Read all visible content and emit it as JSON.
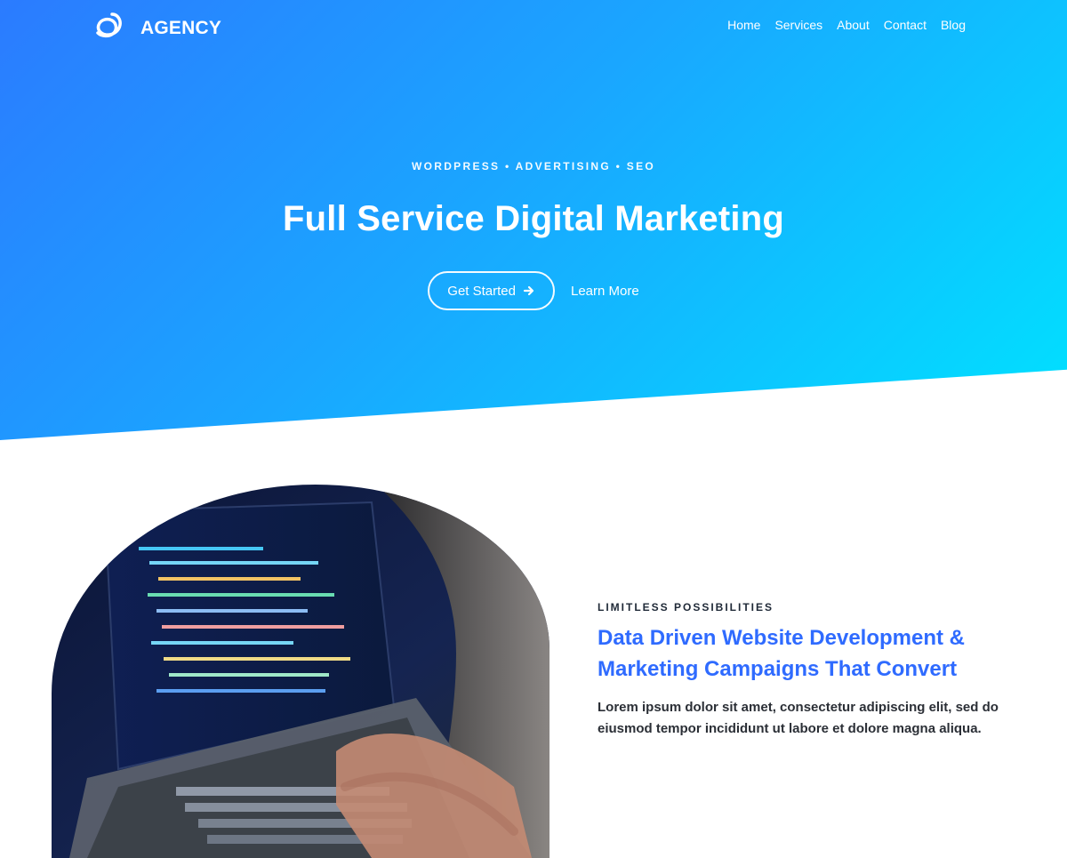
{
  "brand": {
    "name": "AGENCY",
    "logo_icon": "agency-logo-icon"
  },
  "nav": {
    "items": [
      {
        "label": "Home"
      },
      {
        "label": "Services"
      },
      {
        "label": "About"
      },
      {
        "label": "Contact"
      },
      {
        "label": "Blog"
      }
    ]
  },
  "hero": {
    "kicker": "WORDPRESS • ADVERTISING • SEO",
    "title": "Full Service Digital Marketing",
    "primary_cta": {
      "label": "Get Started",
      "icon": "arrow-right-icon"
    },
    "secondary_cta": {
      "label": "Learn More"
    },
    "gradient": {
      "start": "#2b7bff",
      "mid": "#1aa6ff",
      "end": "#00e2ff"
    }
  },
  "content": {
    "eyebrow": "LIMITLESS POSSIBILITIES",
    "headline": "Data Driven Website Development & Marketing Campaigns That Convert",
    "body": "Lorem ipsum dolor sit amet, consectetur adipiscing elit, sed do eiusmod tempor incididunt ut labore et dolore magna aliqua.",
    "accent_color": "#2f6bff"
  },
  "image": {
    "icon": "laptop-code-photo"
  }
}
